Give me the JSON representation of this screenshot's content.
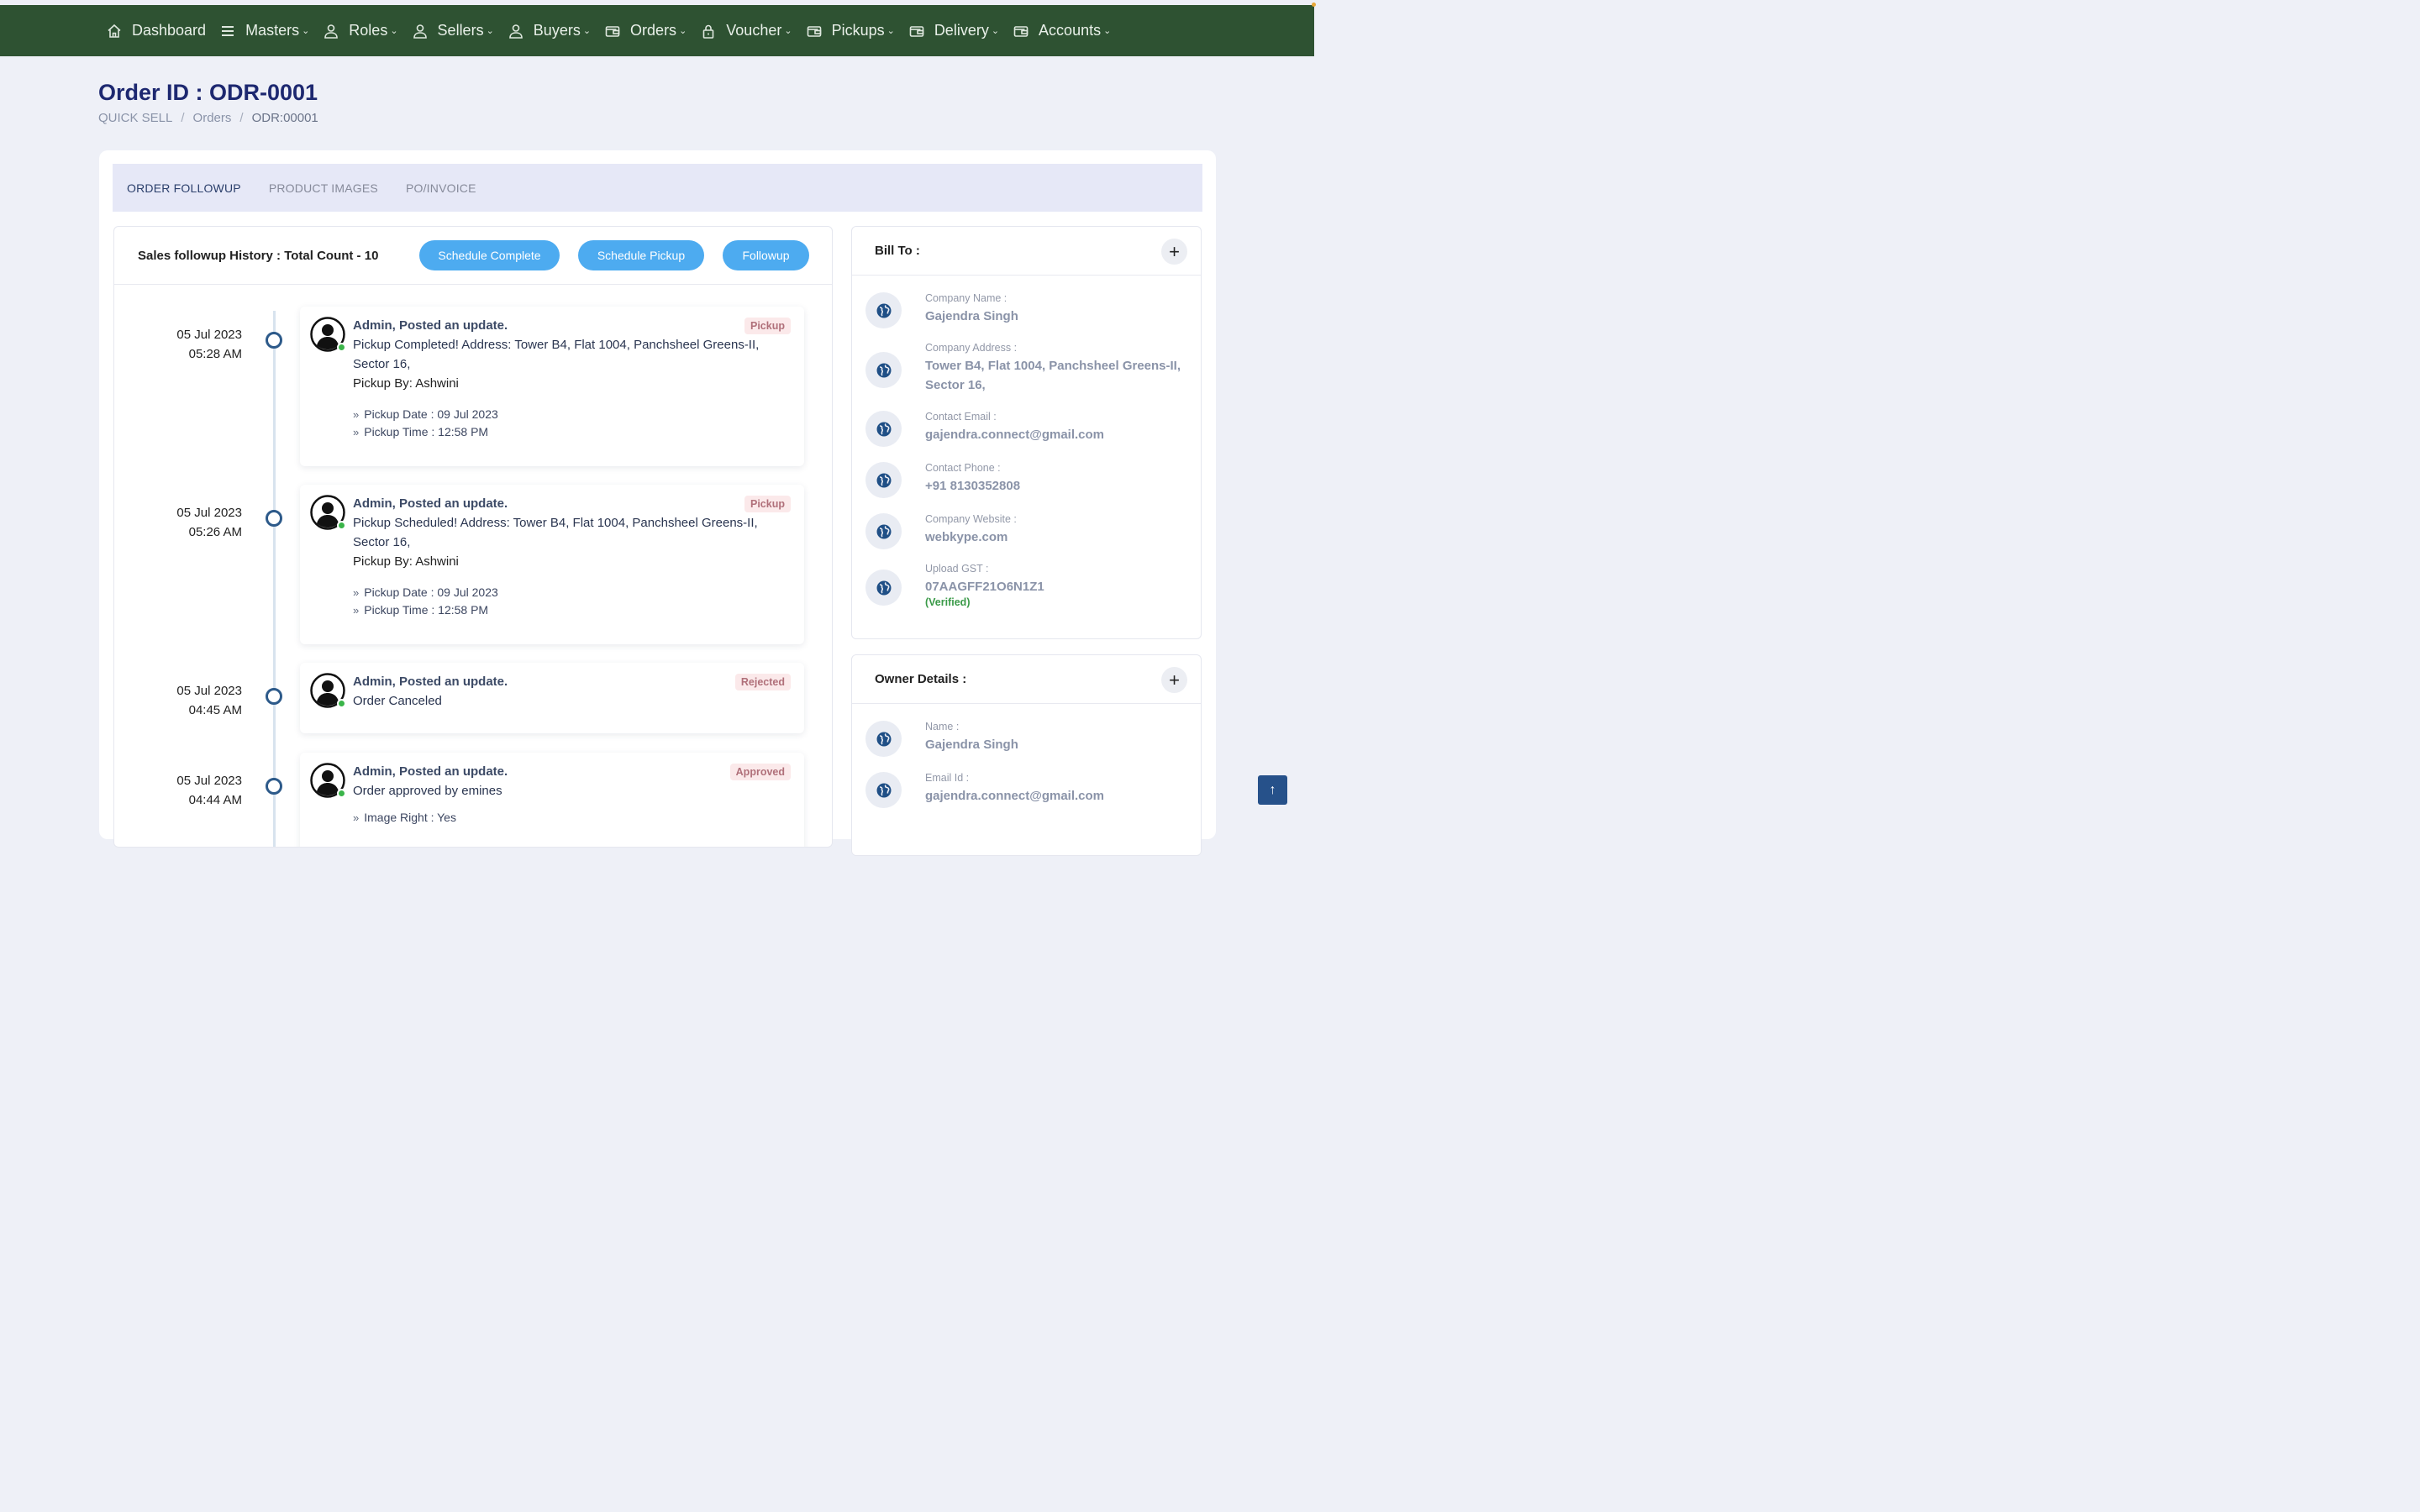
{
  "nav": {
    "items": [
      {
        "label": "Dashboard",
        "icon": "home-icon",
        "has_chevron": false
      },
      {
        "label": "Masters",
        "icon": "menu-icon",
        "has_chevron": true
      },
      {
        "label": "Roles",
        "icon": "user-icon",
        "has_chevron": true
      },
      {
        "label": "Sellers",
        "icon": "user-icon",
        "has_chevron": true
      },
      {
        "label": "Buyers",
        "icon": "user-icon",
        "has_chevron": true
      },
      {
        "label": "Orders",
        "icon": "wallet-icon",
        "has_chevron": true
      },
      {
        "label": "Voucher",
        "icon": "lock-icon",
        "has_chevron": true
      },
      {
        "label": "Pickups",
        "icon": "wallet-icon",
        "has_chevron": true
      },
      {
        "label": "Delivery",
        "icon": "wallet-icon",
        "has_chevron": true
      },
      {
        "label": "Accounts",
        "icon": "wallet-icon",
        "has_chevron": true
      }
    ]
  },
  "page": {
    "title": "Order ID : ODR-0001",
    "breadcrumb": [
      "QUICK SELL",
      "Orders",
      "ODR:00001"
    ]
  },
  "tabs": [
    "ORDER FOLLOWUP",
    "PRODUCT IMAGES",
    "PO/INVOICE"
  ],
  "followup": {
    "title": "Sales followup History : Total Count - 10",
    "buttons": {
      "schedule_complete": "Schedule Complete",
      "schedule_pickup": "Schedule Pickup",
      "followup": "Followup"
    },
    "entries": [
      {
        "date": "05 Jul 2023",
        "time": "05:28 AM",
        "head": "Admin, Posted an update.",
        "badge": "Pickup",
        "text": "Pickup Completed! Address: Tower B4, Flat 1004, Panchsheel Greens-II, Sector 16,",
        "by": "Pickup By: Ashwini",
        "meta1": "Pickup Date : 09 Jul 2023",
        "meta2": "Pickup Time : 12:58 PM"
      },
      {
        "date": "05 Jul 2023",
        "time": "05:26 AM",
        "head": "Admin, Posted an update.",
        "badge": "Pickup",
        "text": "Pickup Scheduled! Address: Tower B4, Flat 1004, Panchsheel Greens-II, Sector 16,",
        "by": "Pickup By: Ashwini",
        "meta1": "Pickup Date : 09 Jul 2023",
        "meta2": "Pickup Time : 12:58 PM"
      },
      {
        "date": "05 Jul 2023",
        "time": "04:45 AM",
        "head": "Admin, Posted an update.",
        "badge": "Rejected",
        "text": "Order Canceled"
      },
      {
        "date": "05 Jul 2023",
        "time": "04:44 AM",
        "head": "Admin, Posted an update.",
        "badge": "Approved",
        "text": "Order approved by emines",
        "meta1": "Image Right : Yes"
      }
    ]
  },
  "bill_to": {
    "title": "Bill To :",
    "plus": "+",
    "fields": [
      {
        "label": "Company Name :",
        "value": "Gajendra Singh"
      },
      {
        "label": "Company Address :",
        "value": "Tower B4, Flat 1004, Panchsheel Greens-II, Sector 16,"
      },
      {
        "label": "Contact Email :",
        "value": "gajendra.connect@gmail.com"
      },
      {
        "label": "Contact Phone :",
        "value": "+91 8130352808"
      },
      {
        "label": "Company Website :",
        "value": "webkype.com"
      },
      {
        "label": "Upload GST :",
        "value": "07AAGFF21O6N1Z1",
        "status": "(Verified)"
      }
    ]
  },
  "owner": {
    "title": "Owner Details :",
    "plus": "+",
    "fields": [
      {
        "label": "Name :",
        "value": "Gajendra Singh"
      },
      {
        "label": "Email Id :",
        "value": "gajendra.connect@gmail.com"
      }
    ]
  },
  "scroll_top": "↑"
}
